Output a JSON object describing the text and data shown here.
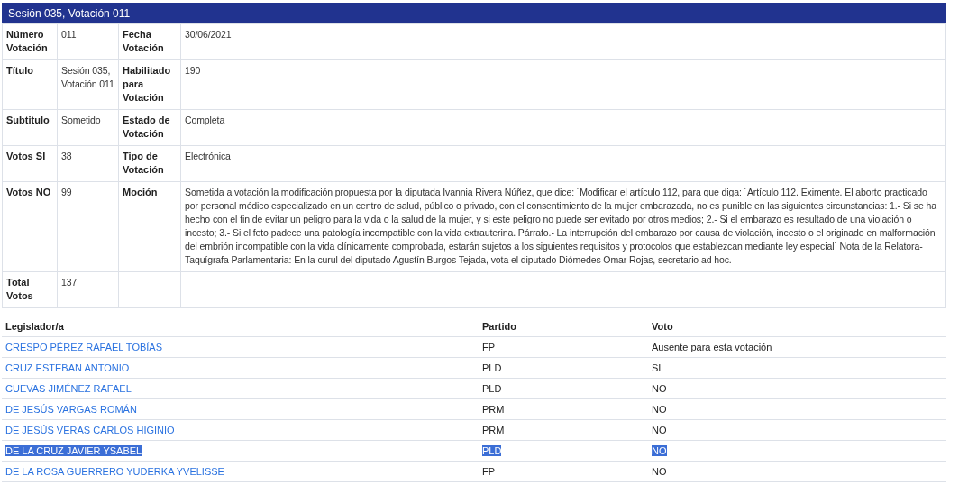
{
  "header": {
    "title": "Sesión 035, Votación 011"
  },
  "details": [
    [
      {
        "label": "Número Votación",
        "value": "011"
      },
      {
        "label": "Fecha Votación",
        "value": "30/06/2021"
      }
    ],
    [
      {
        "label": "Título",
        "value": "Sesión 035, Votación 011"
      },
      {
        "label": "Habilitado para Votación",
        "value": "190"
      }
    ],
    [
      {
        "label": "Subtitulo",
        "value": "Sometido"
      },
      {
        "label": "Estado de Votación",
        "value": "Completa"
      }
    ],
    [
      {
        "label": "Votos SI",
        "value": "38"
      },
      {
        "label": "Tipo de Votación",
        "value": "Electrónica"
      }
    ],
    [
      {
        "label": "Votos NO",
        "value": "99"
      },
      {
        "label": "Moción",
        "value": "Sometida a votación la modificación propuesta por la diputada Ivannia Rivera Núñez, que dice: ´Modificar el artículo 112, para que diga: ´Artículo 112. Eximente. El aborto practicado por personal médico especializado en un centro de salud, público o privado, con el consentimiento de la mujer embarazada, no es punible en las siguientes circunstancias: 1.- Si se ha hecho con el fin de evitar un peligro para la vida o la salud de la mujer, y si este peligro no puede ser evitado por otros medios; 2.- Si el embarazo es resultado de una violación o incesto; 3.- Si el feto padece una patología incompatible con la vida extrauterina. Párrafo.- La interrupción del embarazo por causa de violación, incesto o el originado en malformación del embrión incompatible con la vida clínicamente comprobada, estarán sujetos a los siguientes requisitos y protocolos que establezcan mediante ley especial´ Nota de la Relatora-Taquígrafa Parlamentaria: En la curul del diputado Agustín Burgos Tejada, vota el diputado Diómedes Omar Rojas, secretario ad hoc."
      }
    ],
    [
      {
        "label": "Total Votos",
        "value": "137"
      }
    ]
  ],
  "votes": {
    "columns": [
      "Legislador/a",
      "Partido",
      "Voto"
    ],
    "rows": [
      {
        "name": "CRESPO PÉREZ RAFAEL TOBÍAS",
        "party": "FP",
        "vote": "Ausente para esta votación",
        "selected": false
      },
      {
        "name": "CRUZ ESTEBAN ANTONIO",
        "party": "PLD",
        "vote": "SI",
        "selected": false
      },
      {
        "name": "CUEVAS JIMÉNEZ RAFAEL",
        "party": "PLD",
        "vote": "NO",
        "selected": false
      },
      {
        "name": "DE JESÚS VARGAS ROMÁN",
        "party": "PRM",
        "vote": "NO",
        "selected": false
      },
      {
        "name": "DE JESÚS VERAS CARLOS HIGINIO",
        "party": "PRM",
        "vote": "NO",
        "selected": false
      },
      {
        "name": "DE LA CRUZ JAVIER YSABEL",
        "party": "PLD",
        "vote": "NO",
        "selected": true
      },
      {
        "name": "DE LA ROSA GUERRERO YUDERKA YVELISSE",
        "party": "FP",
        "vote": "NO",
        "selected": false
      }
    ]
  }
}
